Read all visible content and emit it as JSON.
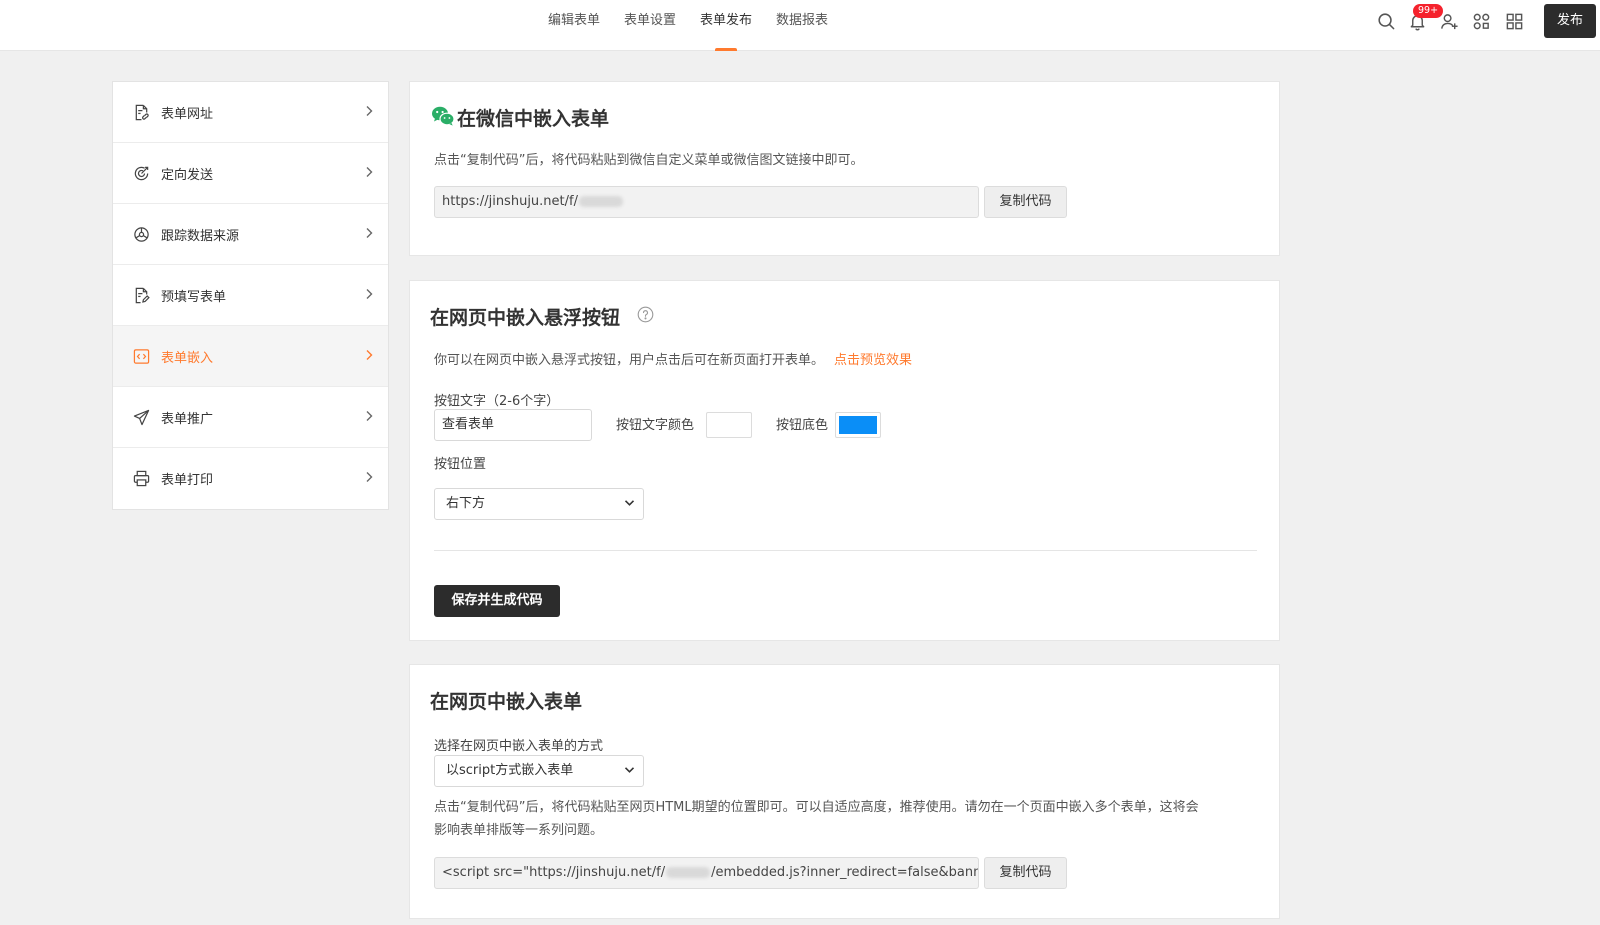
{
  "header": {
    "tabs": [
      "编辑表单",
      "表单设置",
      "表单发布",
      "数据报表"
    ],
    "active_tab": 2,
    "notification_badge": "99+",
    "publish_label": "发布",
    "icons": [
      "search-icon",
      "bell-icon",
      "add-user-icon",
      "collaborate-icon",
      "grid-icon"
    ]
  },
  "sidebar": {
    "items": [
      {
        "label": "表单网址",
        "icon": "form-link-icon"
      },
      {
        "label": "定向发送",
        "icon": "target-send-icon"
      },
      {
        "label": "跟踪数据来源",
        "icon": "track-source-icon"
      },
      {
        "label": "预填写表单",
        "icon": "prefill-icon"
      },
      {
        "label": "表单嵌入",
        "icon": "embed-icon"
      },
      {
        "label": "表单推广",
        "icon": "paper-plane-icon"
      },
      {
        "label": "表单打印",
        "icon": "printer-icon"
      }
    ],
    "active_index": 4
  },
  "wechat_section": {
    "title": "在微信中嵌入表单",
    "description": "点击“复制代码”后，将代码粘贴到微信自定义菜单或微信图文链接中即可。",
    "code_prefix": "https://jinshuju.net/f/",
    "copy_label": "复制代码"
  },
  "float_section": {
    "title": "在网页中嵌入悬浮按钮",
    "description": "你可以在网页中嵌入悬浮式按钮，用户点击后可在新页面打开表单。",
    "preview_link": "点击预览效果",
    "button_text_label": "按钮文字（2-6个字）",
    "button_text_value": "查看表单",
    "text_color_label": "按钮文字颜色",
    "text_color": "#ffffff",
    "bg_color_label": "按钮底色",
    "bg_color": "#0a8ef7",
    "position_label": "按钮位置",
    "position_value": "右下方",
    "save_label": "保存并生成代码"
  },
  "page_section": {
    "title": "在网页中嵌入表单",
    "method_label": "选择在网页中嵌入表单的方式",
    "method_value": "以script方式嵌入表单",
    "description_line1": "点击“复制代码”后，将代码粘贴至网页HTML期望的位置即可。可以自适应高度，推荐使用。请勿在一个页面中嵌入多个表单，这将会",
    "description_line2": "影响表单排版等一系列问题。",
    "code_prefix": "<script src=\"https://jinshuju.net/f/",
    "code_suffix": "/embedded.js?inner_redirect=false&banner=",
    "copy_label": "复制代码"
  },
  "colors": {
    "accent": "#ff7a2e",
    "dark_button": "#2c2c2c",
    "badge": "#f5222d",
    "wechat_green": "#2aae67"
  }
}
